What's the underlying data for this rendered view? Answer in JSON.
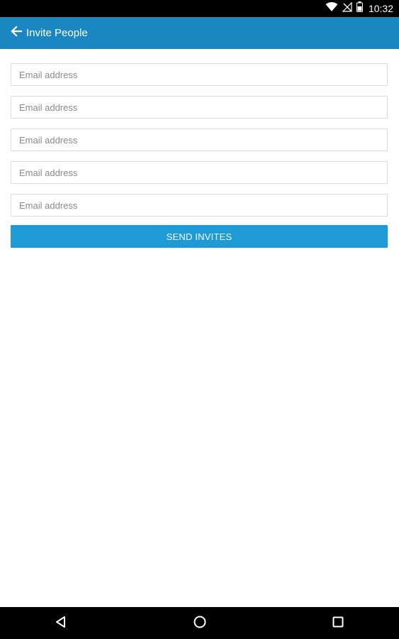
{
  "status_bar": {
    "time": "10:32",
    "icons": [
      "wifi-icon",
      "no-signal-icon",
      "battery-icon"
    ]
  },
  "app_bar": {
    "title": "Invite People",
    "back_icon": "arrow-back-icon",
    "color": "#1a87c2"
  },
  "form": {
    "fields": [
      {
        "placeholder": "Email address",
        "value": ""
      },
      {
        "placeholder": "Email address",
        "value": ""
      },
      {
        "placeholder": "Email address",
        "value": ""
      },
      {
        "placeholder": "Email address",
        "value": ""
      },
      {
        "placeholder": "Email address",
        "value": ""
      }
    ],
    "send_label": "SEND INVITES",
    "button_color": "#1e9ad6"
  },
  "nav_bar": {
    "icons": [
      "back-triangle-icon",
      "home-circle-icon",
      "recents-square-icon"
    ]
  }
}
